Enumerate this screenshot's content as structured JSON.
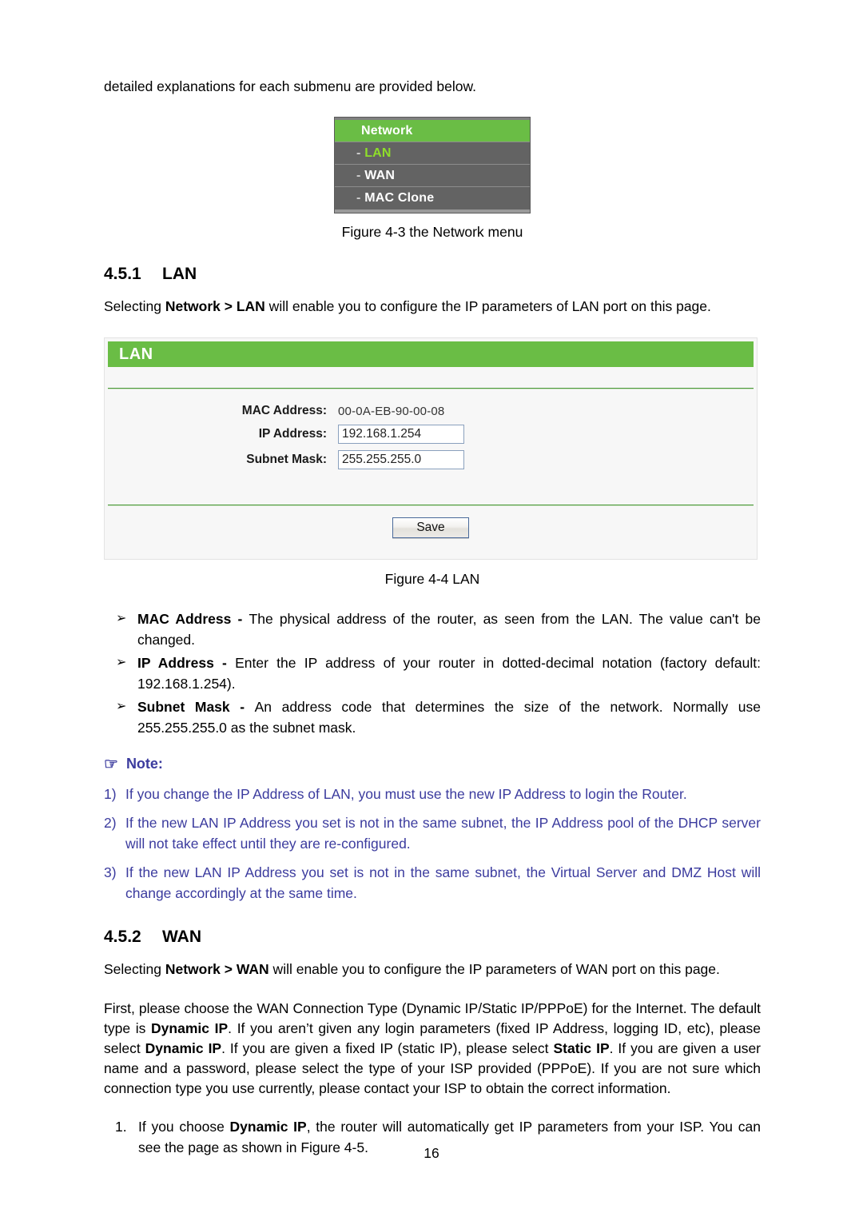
{
  "document": {
    "intro_line": "detailed explanations for each submenu are provided below.",
    "page_number": "16"
  },
  "network_menu": {
    "header": "Network",
    "items": [
      {
        "dash": "-",
        "label": "LAN",
        "selected": true
      },
      {
        "dash": "-",
        "label": "WAN",
        "selected": false
      },
      {
        "dash": "-",
        "label": "MAC Clone",
        "selected": false
      }
    ],
    "caption": "Figure 4-3 the Network menu",
    "colors": {
      "header_green": "#6abd45",
      "item_gray": "#636363",
      "selected_green": "#8ede2a"
    }
  },
  "section_lan": {
    "number": "4.5.1",
    "title": "LAN",
    "intro_pre": "Selecting ",
    "intro_bold": "Network > LAN",
    "intro_post": " will enable you to configure the IP parameters of LAN port on this page."
  },
  "lan_panel": {
    "header_title": "LAN",
    "fields": [
      {
        "label": "MAC Address:",
        "value": "00-0A-EB-90-00-08",
        "type": "static"
      },
      {
        "label": "IP Address:",
        "value": "192.168.1.254",
        "type": "input"
      },
      {
        "label": "Subnet Mask:",
        "value": "255.255.255.0",
        "type": "input"
      }
    ],
    "save_label": "Save",
    "caption": "Figure 4-4 LAN",
    "colors": {
      "header_green": "#6abd45",
      "divider_green": "#4c9a3a",
      "panel_bg": "#f7f7f7",
      "input_border": "#8aa0bd"
    }
  },
  "lan_bullets": [
    {
      "marker": "➢",
      "term": "MAC Address - ",
      "text": "The physical address of the router, as seen from the LAN. The value can't be changed."
    },
    {
      "marker": "➢",
      "term": "IP Address - ",
      "text": "Enter the IP address of your router in dotted-decimal notation (factory default: 192.168.1.254)."
    },
    {
      "marker": "➢",
      "term": "Subnet Mask - ",
      "text": "An address code that determines the size of the network. Normally use 255.255.255.0 as the subnet mask."
    }
  ],
  "note": {
    "icon": "☞",
    "title": "Note:",
    "color": "#3b3b9e",
    "items": [
      {
        "num": "1)",
        "text": "If you change the IP Address of LAN, you must use the new IP Address to login the Router."
      },
      {
        "num": "2)",
        "text": "If the new LAN IP Address you set is not in the same subnet, the IP Address pool of the DHCP server will not take effect until they are re-configured."
      },
      {
        "num": "3)",
        "text": "If the new LAN IP Address you set is not in the same subnet, the Virtual Server and DMZ Host will change accordingly at the same time."
      }
    ]
  },
  "section_wan": {
    "number": "4.5.2",
    "title": "WAN",
    "intro_pre": "Selecting ",
    "intro_bold": "Network > WAN",
    "intro_post": " will enable you to configure the IP parameters of WAN port on this page.",
    "body_1": "First, please choose the WAN Connection Type (Dynamic IP/Static IP/PPPoE) for the Internet. The default type is ",
    "body_b1": "Dynamic IP",
    "body_2": ". If you aren’t given any login parameters (fixed IP Address, logging ID, etc), please select ",
    "body_b2": "Dynamic IP",
    "body_3": ". If you are given a fixed IP (static IP), please select ",
    "body_b3": "Static IP",
    "body_4": ". If you are given a user name and a password, please select the type of your ISP provided (PPPoE). If you are not sure which connection type you use currently, please contact your ISP to obtain the correct information.",
    "list": [
      {
        "num": "1.",
        "pre": "If you choose ",
        "bold": "Dynamic IP",
        "post": ", the router will automatically get IP parameters from your ISP. You can see the page as shown in Figure 4-5."
      }
    ]
  }
}
